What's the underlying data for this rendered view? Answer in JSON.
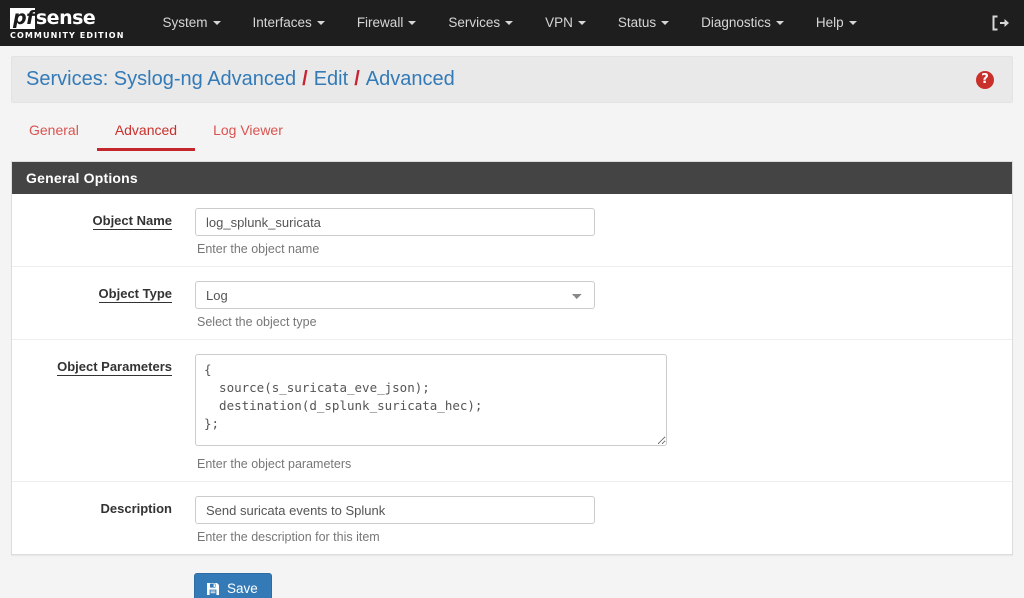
{
  "navbar": {
    "brand": {
      "pf": "pf",
      "sense": "sense",
      "subtitle": "COMMUNITY EDITION"
    },
    "items": [
      {
        "label": "System",
        "has_caret": true
      },
      {
        "label": "Interfaces",
        "has_caret": true
      },
      {
        "label": "Firewall",
        "has_caret": true
      },
      {
        "label": "Services",
        "has_caret": true
      },
      {
        "label": "VPN",
        "has_caret": true
      },
      {
        "label": "Status",
        "has_caret": true
      },
      {
        "label": "Diagnostics",
        "has_caret": true
      },
      {
        "label": "Help",
        "has_caret": true
      }
    ],
    "logout_icon": "logout-icon"
  },
  "breadcrumb": {
    "crumbs": [
      "Services: Syslog-ng Advanced",
      "Edit",
      "Advanced"
    ],
    "separator": "/",
    "help_icon_label": "?"
  },
  "tabs": [
    {
      "label": "General",
      "active": false
    },
    {
      "label": "Advanced",
      "active": true
    },
    {
      "label": "Log Viewer",
      "active": false
    }
  ],
  "panel": {
    "heading": "General Options",
    "fields": [
      {
        "label": "Object Name",
        "required": true,
        "type": "text",
        "value": "log_splunk_suricata",
        "help": "Enter the object name"
      },
      {
        "label": "Object Type",
        "required": true,
        "type": "select",
        "value": "Log",
        "options": [
          "Log"
        ],
        "help": "Select the object type"
      },
      {
        "label": "Object Parameters",
        "required": true,
        "type": "textarea",
        "value": "{\n  source(s_suricata_eve_json);\n  destination(d_splunk_suricata_hec);\n};",
        "help": "Enter the object parameters"
      },
      {
        "label": "Description",
        "required": false,
        "type": "text",
        "value": "Send suricata events to Splunk",
        "help": "Enter the description for this item"
      }
    ]
  },
  "actions": {
    "save_label": "Save",
    "save_icon": "save-floppy-icon"
  },
  "colors": {
    "navbar_bg": "#1e1e1e",
    "page_bg": "#f4f4f4",
    "panel_heading_bg": "#444444",
    "breadcrumb_link": "#337ab7",
    "breadcrumb_sep": "#c82333",
    "tab_active": "#c3272b",
    "primary_button": "#337ab7",
    "help_icon": "#c9302c"
  }
}
